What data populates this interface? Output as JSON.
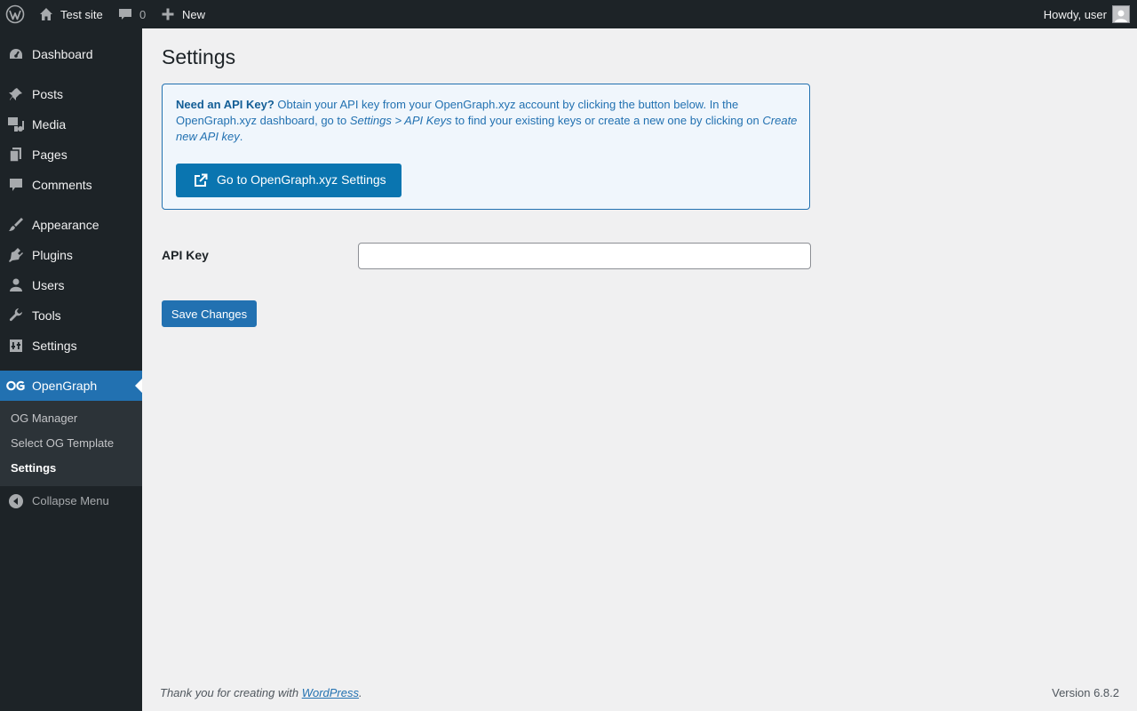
{
  "admin_bar": {
    "site_name": "Test site",
    "comments_count": "0",
    "new_label": "New",
    "greeting": "Howdy, user"
  },
  "sidebar": {
    "items": [
      {
        "label": "Dashboard",
        "icon": "dashboard-icon"
      },
      {
        "label": "Posts",
        "icon": "pin-icon"
      },
      {
        "label": "Media",
        "icon": "media-icon"
      },
      {
        "label": "Pages",
        "icon": "pages-icon"
      },
      {
        "label": "Comments",
        "icon": "comment-icon"
      },
      {
        "label": "Appearance",
        "icon": "brush-icon"
      },
      {
        "label": "Plugins",
        "icon": "plugin-icon"
      },
      {
        "label": "Users",
        "icon": "user-icon"
      },
      {
        "label": "Tools",
        "icon": "wrench-icon"
      },
      {
        "label": "Settings",
        "icon": "settings-icon"
      },
      {
        "label": "OpenGraph",
        "icon": "og-logo-icon"
      }
    ],
    "submenu": [
      {
        "label": "OG Manager"
      },
      {
        "label": "Select OG Template"
      },
      {
        "label": "Settings"
      }
    ],
    "collapse_label": "Collapse Menu"
  },
  "main": {
    "title": "Settings",
    "notice": {
      "heading": "Need an API Key?",
      "text1": " Obtain your API key from your OpenGraph.xyz account by clicking the button below. In the OpenGraph.xyz dashboard, go to ",
      "path": "Settings > API Keys",
      "text2": " to find your existing keys or create a new one by clicking on ",
      "action": "Create new API key",
      "text3": ".",
      "button_label": "Go to OpenGraph.xyz Settings"
    },
    "api_key_label": "API Key",
    "api_key_value": "",
    "save_label": "Save Changes"
  },
  "footer": {
    "thanks_prefix": "Thank you for creating with ",
    "thanks_link": "WordPress",
    "thanks_suffix": ".",
    "version": "Version 6.8.2"
  },
  "colors": {
    "admin_bar_bg": "#1d2327",
    "accent": "#2271b1",
    "og_button": "#0a75b0",
    "notice_bg": "#f0f6fc",
    "submenu_bg": "#2c3338"
  }
}
